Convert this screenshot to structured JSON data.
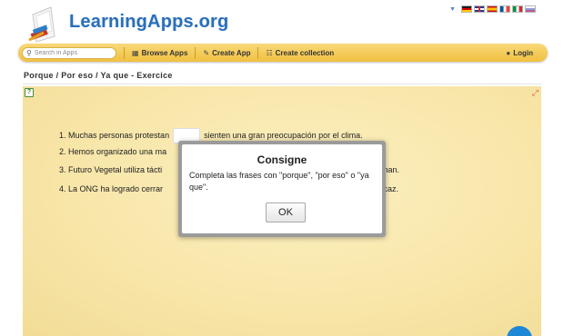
{
  "header": {
    "logo_text": "LearningApps.org",
    "logo_icon": "learningapps-logo-icon",
    "languages": [
      "de",
      "en",
      "es",
      "fr",
      "it",
      "ru"
    ]
  },
  "navbar": {
    "search_placeholder": "Search in Apps",
    "browse_label": "Browse Apps",
    "create_app_label": "Create App",
    "create_collection_label": "Create collection",
    "login_label": "Login"
  },
  "page": {
    "title": "Porque / Por eso / Ya que - Exercice"
  },
  "exercise": {
    "items": [
      {
        "before": "1. Muchas personas protestan",
        "after": "sienten una gran preocupación por el clima."
      },
      {
        "before": "2. Hemos organizado una ma",
        "after": "."
      },
      {
        "before": "3. Futuro Vegetal utiliza tácti",
        "after": "ncionan."
      },
      {
        "before": "4. La ONG ha logrado cerrar",
        "after": "eficaz."
      }
    ]
  },
  "dialog": {
    "title": "Consigne",
    "message": "Completa las frases con \"porque\", \"por eso\" o \"ya que\".",
    "ok_label": "OK"
  },
  "colors": {
    "navbar": "#f3c94f",
    "exercise_bg": "#f8e6a8",
    "logo_blue": "#2a6fb8",
    "fab": "#1e88d6"
  }
}
